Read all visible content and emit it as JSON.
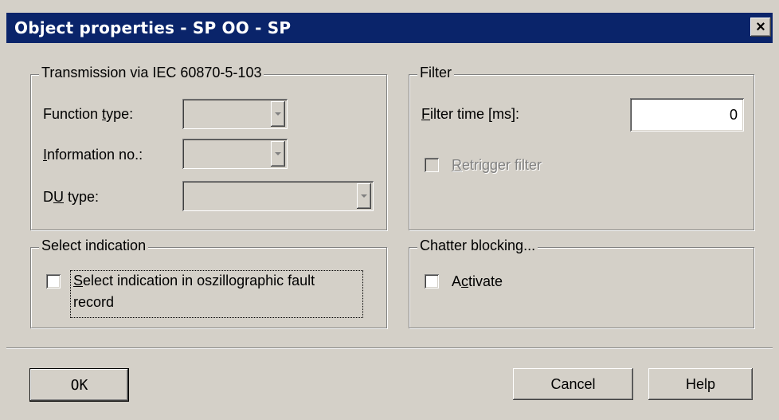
{
  "window": {
    "title": "Object properties - SP OO - SP",
    "close_glyph": "✕"
  },
  "transmission": {
    "legend": "Transmission via IEC 60870-5-103",
    "function_type_label": "Function type:",
    "information_no_label": "Information no.:",
    "du_type_label": "DU type:",
    "function_type_value": "",
    "information_no_value": "",
    "du_type_value": ""
  },
  "filter": {
    "legend": "Filter",
    "filter_time_label": "Filter time [ms]:",
    "filter_time_value": "0",
    "retrigger_label": "Retrigger filter"
  },
  "select_indication": {
    "legend": "Select indication",
    "checkbox_label_line1": "Select indication in oszillographic fault",
    "checkbox_label_line2": "record"
  },
  "chatter": {
    "legend": "Chatter blocking...",
    "activate_label": "Activate"
  },
  "buttons": {
    "ok": "OK",
    "cancel": "Cancel",
    "help": "Help"
  }
}
